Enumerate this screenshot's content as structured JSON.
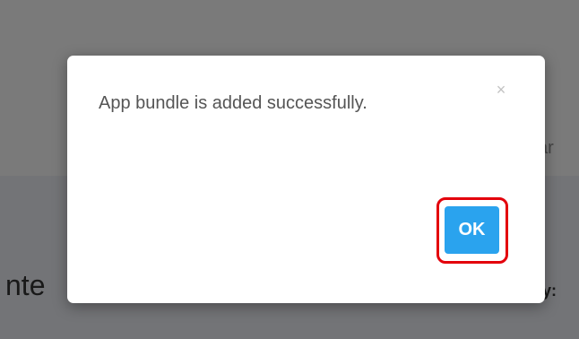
{
  "background": {
    "upper_right_text": "ar",
    "lower_left_text": "nte",
    "lower_right_text": "y:"
  },
  "modal": {
    "message": "App bundle is added successfully.",
    "close_icon": "close-icon",
    "close_glyph": "×",
    "ok_label": "OK"
  },
  "colors": {
    "ok_button": "#2aa3ee",
    "highlight": "#e3000b"
  }
}
